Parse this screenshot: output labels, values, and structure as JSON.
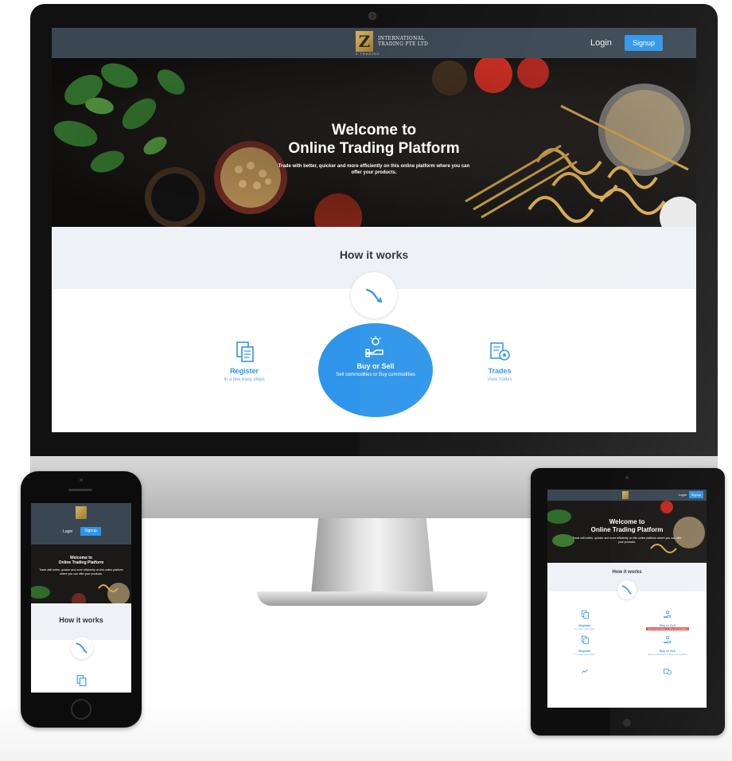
{
  "brand": {
    "logo_letter": "Z",
    "name_line1": "INTERNATIONAL",
    "name_line2": "TRADING PTE LTD",
    "sub": "Z TRADING"
  },
  "nav": {
    "login_label": "Login",
    "signup_label": "Signup"
  },
  "hero": {
    "title_line1": "Welcome to",
    "title_line2": "Online Trading Platform",
    "subtitle": "Trade with better, quicker and more efficiently on this online platform where you can offer your products."
  },
  "how_it_works": {
    "title": "How it works",
    "steps": [
      {
        "title": "Register",
        "subtitle": "In a few easy steps",
        "icon": "document-icon"
      },
      {
        "title": "Buy or Sell",
        "subtitle": "Sell commodities or Buy commodities",
        "icon": "hand-coins-icon"
      },
      {
        "title": "Trades",
        "subtitle": "View trades",
        "icon": "trade-gear-icon"
      }
    ]
  },
  "colors": {
    "topbar": "#3a4753",
    "accent": "#2e95ea",
    "band": "#eef2f6",
    "highlight": "#d9534f"
  }
}
